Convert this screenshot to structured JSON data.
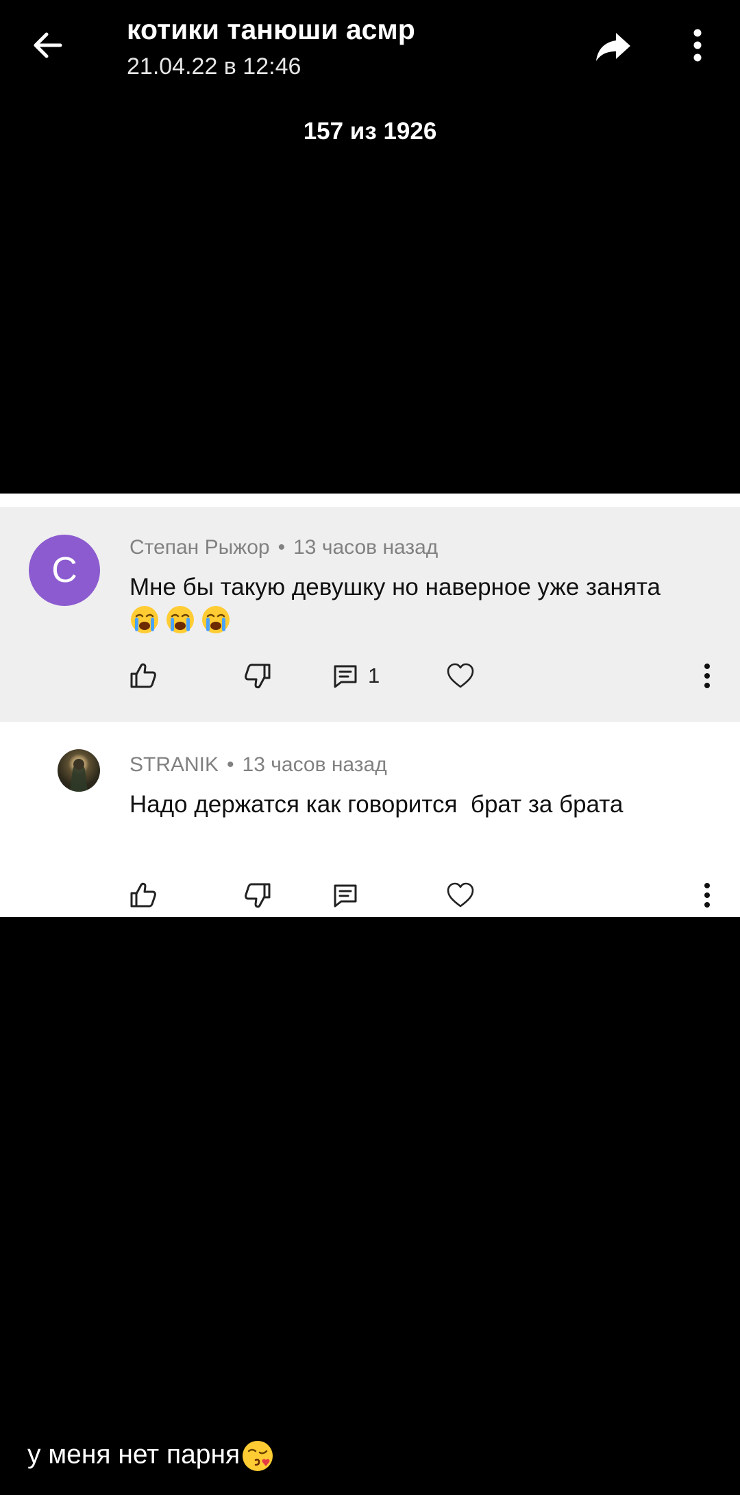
{
  "header": {
    "title": "котики танюши асмр",
    "subtitle": "21.04.22 в 12:46",
    "back_icon": "arrow-left-icon",
    "share_icon": "share-arrow-icon",
    "more_icon": "more-vertical-icon"
  },
  "counter": "157 из 1926",
  "comments": [
    {
      "avatar_letter": "С",
      "avatar_color": "#8c5bd0",
      "author": "Степан Рыжор",
      "time": "13 часов назад",
      "text": "Мне бы такую девушку но наверное уже занята",
      "emoji": [
        "loudly-crying-face",
        "loudly-crying-face",
        "loudly-crying-face"
      ],
      "reply_count": "1"
    },
    {
      "avatar": "user-photo",
      "author": "STRANIK",
      "time": "13 часов назад",
      "text": "Надо держатся как говорится  брат за брата"
    }
  ],
  "caption": {
    "text": "у меня нет парня",
    "emoji": "face-blowing-kiss"
  },
  "colors": {
    "background": "#000000",
    "card": "#ffffff",
    "highlight": "#efefef",
    "meta_text": "#818181",
    "avatar": "#8c5bd0"
  }
}
